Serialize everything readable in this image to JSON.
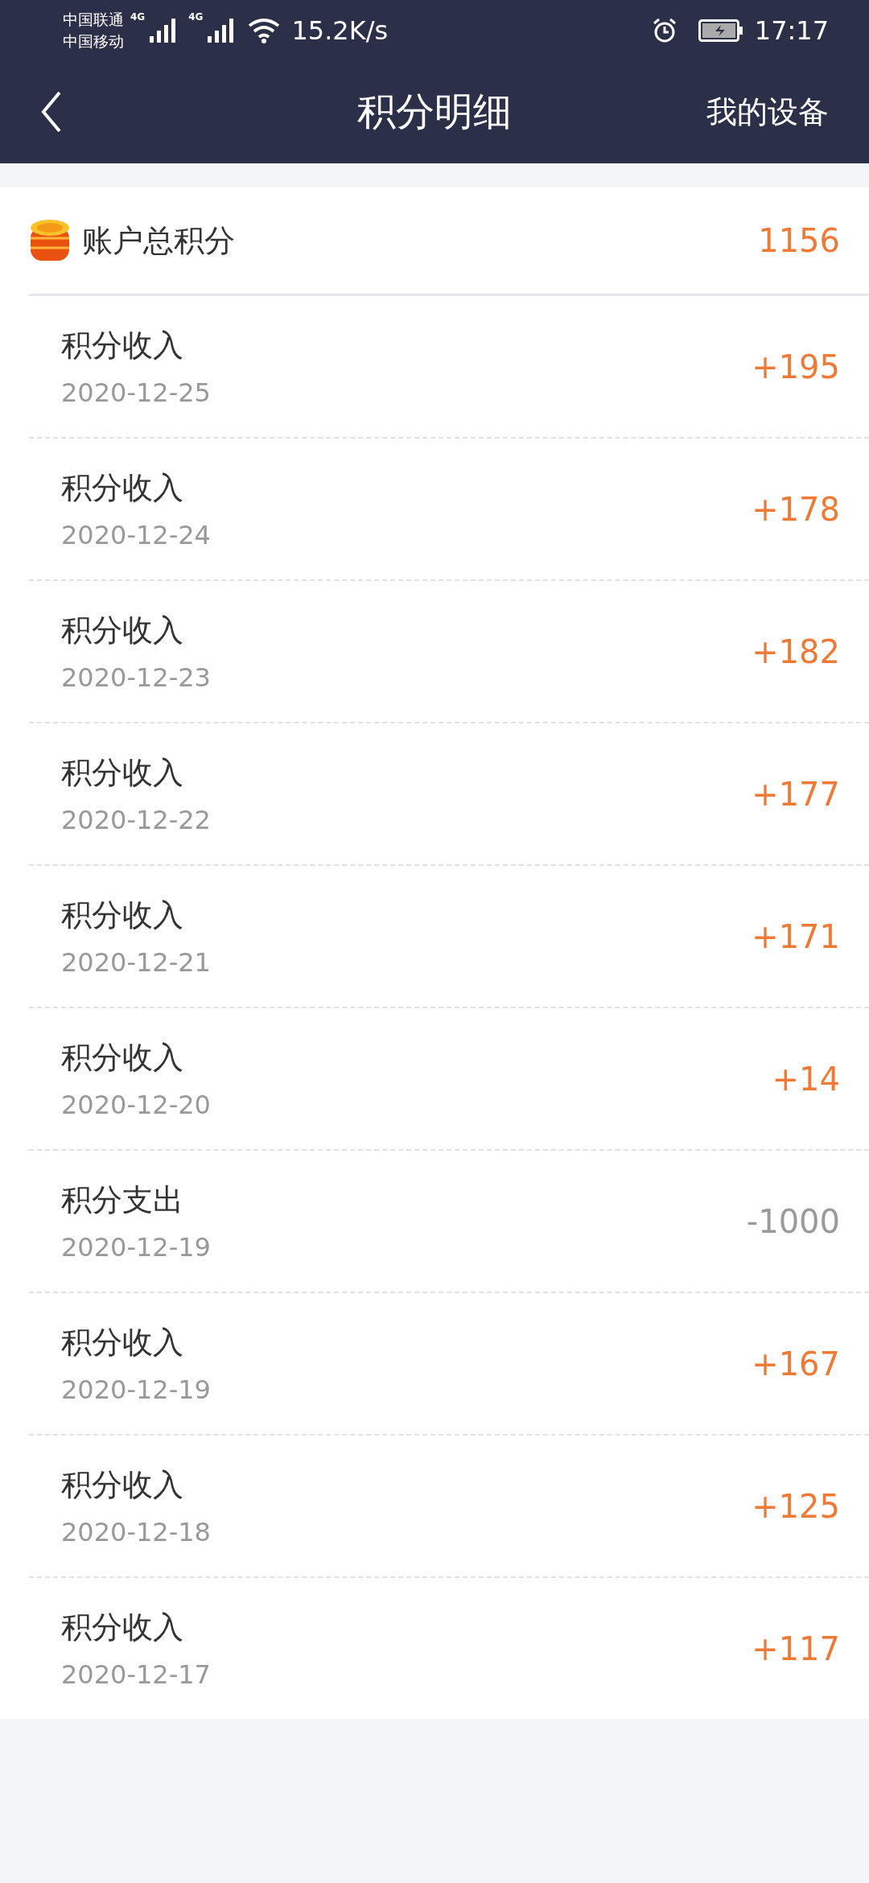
{
  "status_bar": {
    "carriers": [
      "中国联通",
      "中国移动"
    ],
    "network_labels": [
      "4G",
      "4G"
    ],
    "speed": "15.2K/s",
    "time": "17:17"
  },
  "nav": {
    "title": "积分明细",
    "action": "我的设备"
  },
  "total": {
    "label": "账户总积分",
    "value": "1156"
  },
  "transactions": [
    {
      "title": "积分收入",
      "date": "2020-12-25",
      "amount": "+195",
      "kind": "income"
    },
    {
      "title": "积分收入",
      "date": "2020-12-24",
      "amount": "+178",
      "kind": "income"
    },
    {
      "title": "积分收入",
      "date": "2020-12-23",
      "amount": "+182",
      "kind": "income"
    },
    {
      "title": "积分收入",
      "date": "2020-12-22",
      "amount": "+177",
      "kind": "income"
    },
    {
      "title": "积分收入",
      "date": "2020-12-21",
      "amount": "+171",
      "kind": "income"
    },
    {
      "title": "积分收入",
      "date": "2020-12-20",
      "amount": "+14",
      "kind": "income"
    },
    {
      "title": "积分支出",
      "date": "2020-12-19",
      "amount": "-1000",
      "kind": "expense"
    },
    {
      "title": "积分收入",
      "date": "2020-12-19",
      "amount": "+167",
      "kind": "income"
    },
    {
      "title": "积分收入",
      "date": "2020-12-18",
      "amount": "+125",
      "kind": "income"
    },
    {
      "title": "积分收入",
      "date": "2020-12-17",
      "amount": "+117",
      "kind": "income"
    }
  ]
}
